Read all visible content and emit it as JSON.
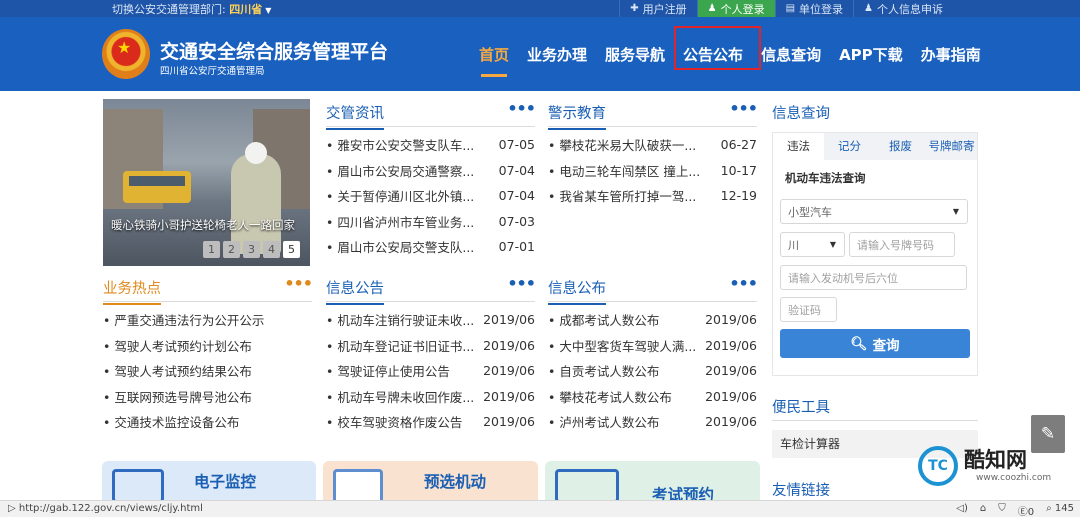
{
  "topbar": {
    "region_label": "切换公安交通管理部门:",
    "region_value": "四川省",
    "links": [
      {
        "icon": "plus-icon",
        "glyph": "✚",
        "label": "用户注册"
      },
      {
        "icon": "user-icon",
        "glyph": "♟",
        "label": "个人登录"
      },
      {
        "icon": "building-icon",
        "glyph": "▤",
        "label": "单位登录"
      },
      {
        "icon": "user-icon",
        "glyph": "♟",
        "label": "个人信息申诉"
      }
    ]
  },
  "header": {
    "title": "交通安全综合服务管理平台",
    "subtitle": "四川省公安厅交通管理局",
    "nav": [
      "首页",
      "业务办理",
      "服务导航",
      "公告公布",
      "信息查询",
      "APP下载",
      "办事指南"
    ]
  },
  "slideshow": {
    "caption": "暖心铁骑小哥护送轮椅老人一路回家",
    "pages": [
      "1",
      "2",
      "3",
      "4",
      "5"
    ]
  },
  "panels": {
    "jiaoguan": {
      "title": "交管资讯",
      "items": [
        {
          "title": "雅安市公安交警支队车...",
          "date": "07-05"
        },
        {
          "title": "眉山市公安局交通警察...",
          "date": "07-04"
        },
        {
          "title": "关于暂停通川区北外镇...",
          "date": "07-04"
        },
        {
          "title": "四川省泸州市车管业务...",
          "date": "07-03"
        },
        {
          "title": "眉山市公安局交警支队...",
          "date": "07-01"
        }
      ]
    },
    "jingshi": {
      "title": "警示教育",
      "items": [
        {
          "title": "攀枝花米易大队破获一...",
          "date": "06-27"
        },
        {
          "title": "电动三轮车闯禁区 撞上...",
          "date": "10-17"
        },
        {
          "title": "我省某车管所打掉一驾...",
          "date": "12-19"
        }
      ]
    },
    "yewu": {
      "title": "业务热点",
      "items": [
        {
          "title": "严重交通违法行为公开公示",
          "date": ""
        },
        {
          "title": "驾驶人考试预约计划公布",
          "date": ""
        },
        {
          "title": "驾驶人考试预约结果公布",
          "date": ""
        },
        {
          "title": "互联网预选号牌号池公布",
          "date": ""
        },
        {
          "title": "交通技术监控设备公布",
          "date": ""
        }
      ]
    },
    "xinxi_gonggao": {
      "title": "信息公告",
      "items": [
        {
          "title": "机动车注销行驶证未收...",
          "date": "2019/06"
        },
        {
          "title": "机动车登记证书旧证书...",
          "date": "2019/06"
        },
        {
          "title": "驾驶证停止使用公告",
          "date": "2019/06"
        },
        {
          "title": "机动车号牌未收回作废...",
          "date": "2019/06"
        },
        {
          "title": "校车驾驶资格作废公告",
          "date": "2019/06"
        }
      ]
    },
    "xinxi_gongbu": {
      "title": "信息公布",
      "items": [
        {
          "title": "成都考试人数公布",
          "date": "2019/06"
        },
        {
          "title": "大中型客货车驾驶人满...",
          "date": "2019/06"
        },
        {
          "title": "自贡考试人数公布",
          "date": "2019/06"
        },
        {
          "title": "攀枝花考试人数公布",
          "date": "2019/06"
        },
        {
          "title": "泸州考试人数公布",
          "date": "2019/06"
        }
      ]
    }
  },
  "query": {
    "title": "信息查询",
    "tabs": [
      "违法",
      "记分",
      "报废",
      "号牌邮寄"
    ],
    "subtitle": "机动车违法查询",
    "vehicle_type": "小型汽车",
    "province": "川",
    "plate_placeholder": "请输入号牌号码",
    "engine_placeholder": "请输入发动机号后六位",
    "captcha_placeholder": "验证码",
    "button": "查询"
  },
  "tools": {
    "title": "便民工具",
    "item": "车检计算器"
  },
  "friend_links": "友情链接",
  "tiles": [
    {
      "label": "电子监控",
      "bg": "#dbe9f8"
    },
    {
      "label": "预选机动",
      "bg": "#f9e2cf"
    },
    {
      "label": "考试预约",
      "bg": "#dff1e6"
    }
  ],
  "watermark": {
    "logo": "TC",
    "name": "酷知网",
    "url": "www.coozhi.com"
  },
  "statusbar": {
    "url": "http://gab.122.gov.cn/views/cljy.html",
    "zoom": "145"
  },
  "colors": {
    "header_bg": "#1960bf",
    "accent": "#f6a940",
    "highlight": "#e0242a"
  }
}
